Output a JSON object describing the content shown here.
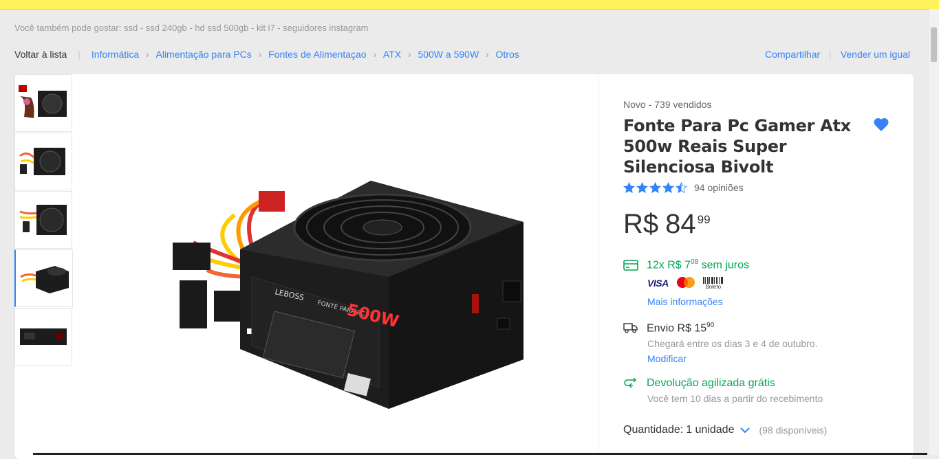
{
  "suggest": {
    "label": "Você também pode gostar:",
    "items": "ssd - ssd 240gb - hd ssd 500gb - kit i7 - seguidores instagram"
  },
  "breadcrumb": {
    "back": "Voltar à lista",
    "items": [
      "Informática",
      "Alimentação para PCs",
      "Fontes de Alimentaçao",
      "ATX",
      "500W a 590W",
      "Otros"
    ]
  },
  "actions": {
    "share": "Compartilhar",
    "sell": "Vender um igual"
  },
  "product": {
    "condition": "Novo  -  739 vendidos",
    "title": "Fonte Para Pc Gamer Atx 500w Reais Super Silenciosa Bivolt",
    "rating": 4.5,
    "reviews": "94 opiniões",
    "price_currency": "R$",
    "price_int": "84",
    "price_cents": "99",
    "installments": "12x R$ 7",
    "installments_cents": "08",
    "installments_suffix": " sem juros",
    "payment": {
      "visa": "VISA",
      "boleto": "Boleto"
    },
    "more_info": "Mais informações",
    "shipping": "Envio R$ 15",
    "shipping_cents": "90",
    "arrival": "Chegará entre os dias 3 e 4 de outubro.",
    "modify": "Modificar",
    "return_title": "Devolução agilizada grátis",
    "return_sub": "Você tem 10 dias a partir do recebimento",
    "qty_label": "Quantidade:",
    "qty_value": "1 unidade",
    "qty_available": "(98 disponíveis)",
    "main_image_text": {
      "brand": "LEBOSS",
      "model": "500W",
      "series": "FONTE PARA PC"
    }
  },
  "colors": {
    "accent": "#3483fa",
    "success": "#00a650",
    "topbar": "#fff159"
  }
}
